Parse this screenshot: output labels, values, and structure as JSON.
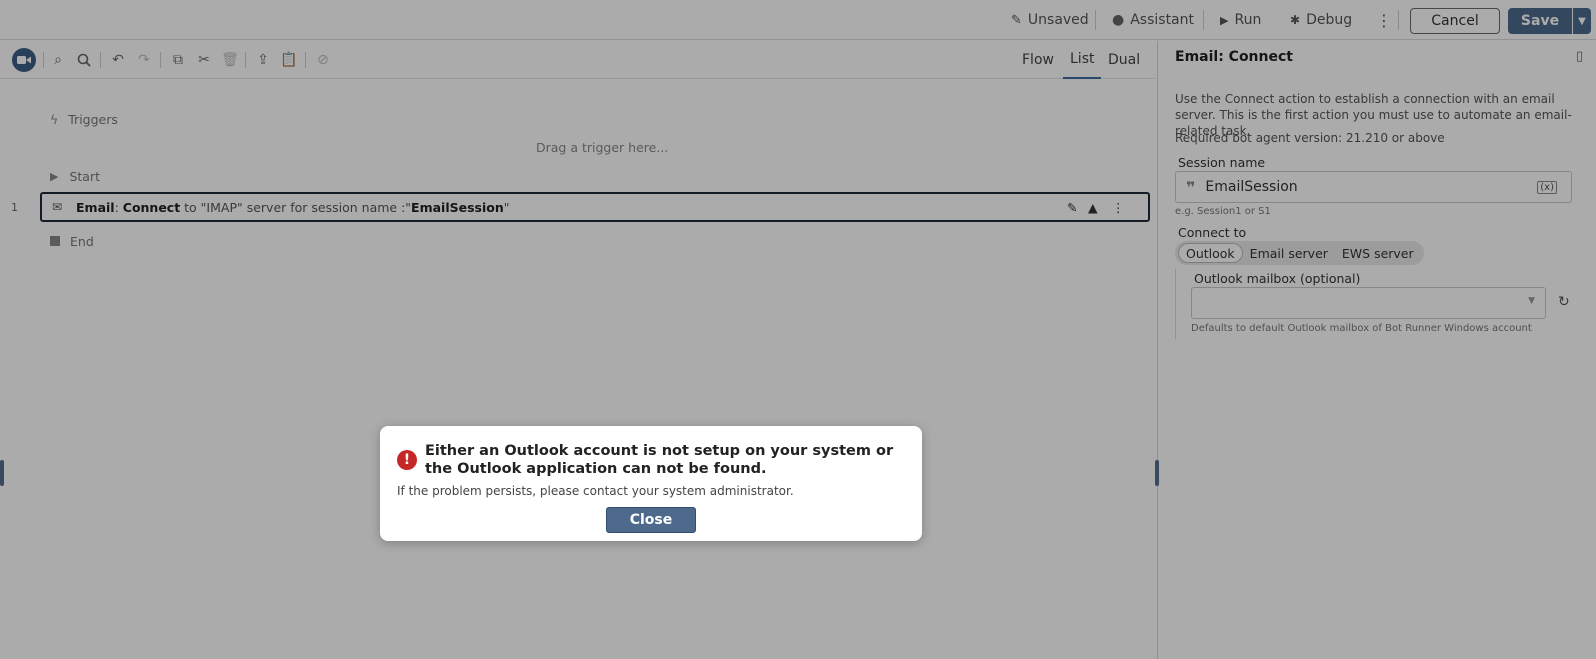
{
  "topbar": {
    "unsaved": "Unsaved",
    "assistant": "Assistant",
    "run": "Run",
    "debug": "Debug",
    "cancel": "Cancel",
    "save": "Save"
  },
  "view_tabs": [
    "Flow",
    "List",
    "Dual"
  ],
  "view_active": "List",
  "list": {
    "triggers": "Triggers",
    "drag_hint": "Drag a trigger here...",
    "start": "Start",
    "line_number": "1",
    "action_name": "Email",
    "action_sep": ": ",
    "action_verb": "Connect",
    "action_text": " to \"IMAP\" server for session name :\"",
    "action_session": "EmailSession",
    "action_end": "\"",
    "end": "End"
  },
  "side": {
    "title": "Email: Connect",
    "description": "Use the Connect action to establish a connection with an email server. This is the first action you must use to automate an email-related task.",
    "version": "Required bot agent version: 21.210 or above",
    "session_label": "Session name",
    "session_value": "EmailSession",
    "session_hint": "e.g. Session1 or S1",
    "connect_label": "Connect to",
    "connect_options": [
      "Outlook",
      "Email server",
      "EWS server"
    ],
    "mailbox_label": "Outlook mailbox (optional)",
    "mailbox_hint": "Defaults to default Outlook mailbox of Bot Runner Windows account"
  },
  "dialog": {
    "title": "Either an Outlook account is not setup on your system or the Outlook application can not be found.",
    "message": "If the problem persists, please contact your system administrator.",
    "close": "Close"
  },
  "colors": {
    "accent": "#4d6a8c",
    "error": "#c62828",
    "overlay": "rgba(0,0,0,0.33)"
  }
}
